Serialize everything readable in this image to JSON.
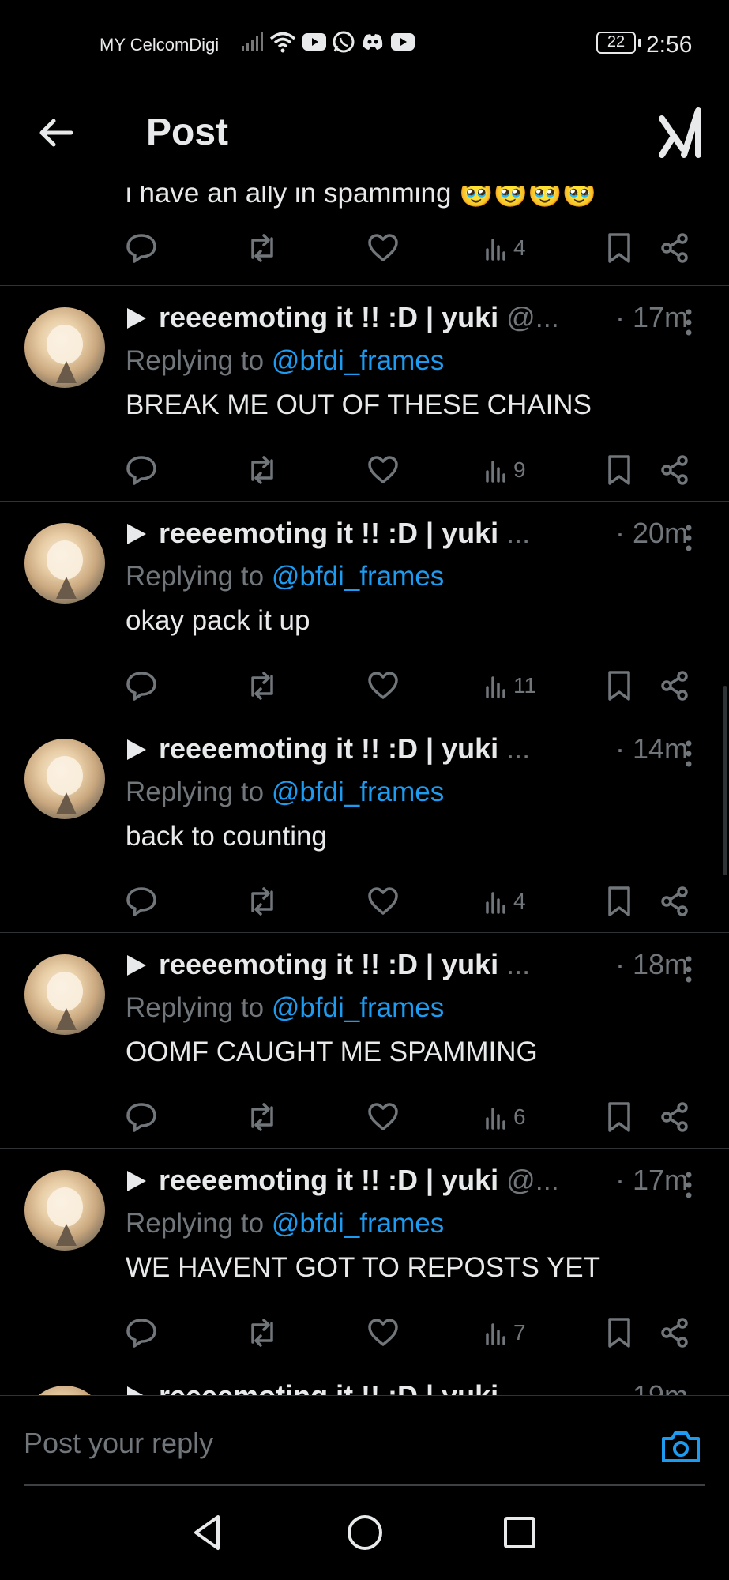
{
  "status_bar": {
    "carrier": "MY CelcomDigi",
    "battery": "22",
    "time": "2:56",
    "icons": [
      "signal-icon",
      "wifi-icon",
      "youtube-icon",
      "whatsapp-icon",
      "discord-icon",
      "youtube-icon"
    ]
  },
  "header": {
    "title": "Post",
    "back_icon": "arrow-left-icon",
    "grok_icon": "grok-icon"
  },
  "partial_tweet": {
    "text": "i have an ally in spamming 🥹🥹🥹🥹",
    "views": "4"
  },
  "tweets": [
    {
      "name": "reeeemoting it !! :D | yuki",
      "handle": "@...",
      "time": "· 17m",
      "replying_label": "Replying to",
      "mention": "@bfdi_frames",
      "text": "BREAK ME OUT OF THESE CHAINS",
      "views": "9"
    },
    {
      "name": "reeeemoting it !! :D | yuki",
      "handle": "...",
      "time": "· 20m",
      "replying_label": "Replying to",
      "mention": "@bfdi_frames",
      "text": "okay pack it up",
      "views": "11"
    },
    {
      "name": "reeeemoting it !! :D | yuki",
      "handle": "...",
      "time": "· 14m",
      "replying_label": "Replying to",
      "mention": "@bfdi_frames",
      "text": "back to counting",
      "views": "4"
    },
    {
      "name": "reeeemoting it !! :D | yuki",
      "handle": "...",
      "time": "· 18m",
      "replying_label": "Replying to",
      "mention": "@bfdi_frames",
      "text": "OOMF CAUGHT ME SPAMMING",
      "views": "6"
    },
    {
      "name": "reeeemoting it !! :D | yuki",
      "handle": "@...",
      "time": "· 17m",
      "replying_label": "Replying to",
      "mention": "@bfdi_frames",
      "text": "WE HAVENT GOT TO REPOSTS YET",
      "views": "7"
    },
    {
      "name": "reeeemoting it !! :D | yuki",
      "handle": "",
      "time": "19m",
      "replying_label": "",
      "mention": "",
      "text": "",
      "views": ""
    }
  ],
  "reply_box": {
    "placeholder": "Post your reply",
    "camera_icon": "camera-icon"
  },
  "nav": [
    "back-triangle-icon",
    "home-circle-icon",
    "recents-square-icon"
  ],
  "colors": {
    "background": "#000000",
    "text": "#e7e9ea",
    "muted": "#71767b",
    "accent": "#1d9bf0",
    "divider": "#2f3336"
  }
}
